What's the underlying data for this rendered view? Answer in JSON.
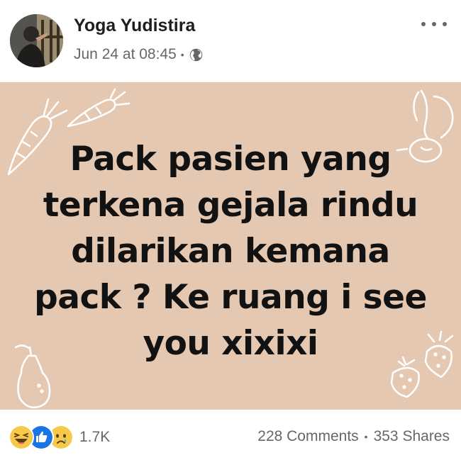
{
  "post": {
    "author": "Yoga Yudistira",
    "timestamp": "Jun 24 at 08:45",
    "separator": "•",
    "privacy_icon": "globe-icon",
    "more_icon": "more-options-icon",
    "image": {
      "background": "#e5c8b2",
      "text": "Pack pasien yang terkena gejala rindu dilarikan kemana pack ? Ke ruang i see you xixixi",
      "lines": [
        "Pack pasien yang",
        "terkena gejala rindu",
        "dilarikan kemana",
        "pack ? Ke ruang i see",
        "you xixixi"
      ],
      "decorations": [
        "carrot-icon",
        "carrot-icon",
        "radish-icon",
        "pear-icon",
        "strawberry-icon",
        "strawberry-icon"
      ]
    },
    "reactions": {
      "icons": [
        "haha-reaction-icon",
        "like-reaction-icon",
        "sad-reaction-icon"
      ],
      "count": "1.7K"
    },
    "comments": "228 Comments",
    "stats_separator": "•",
    "shares": "353 Shares"
  }
}
